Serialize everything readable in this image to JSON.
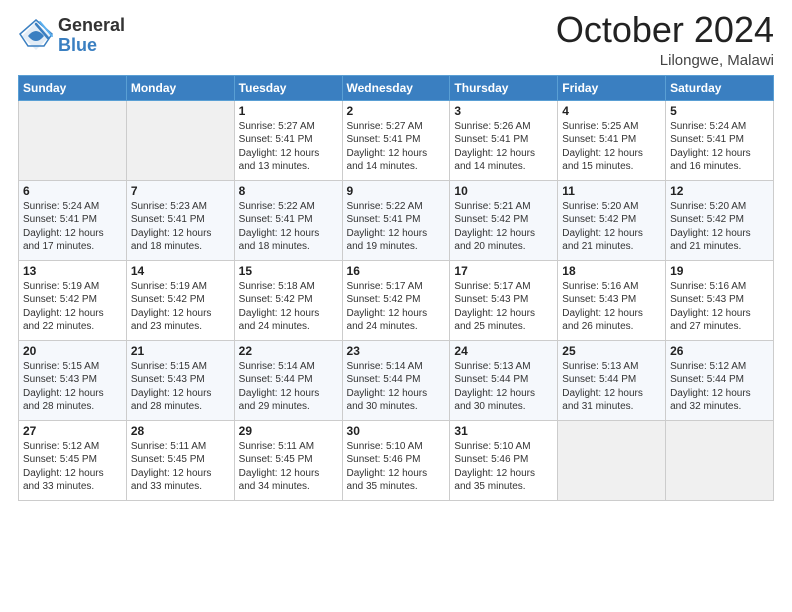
{
  "logo": {
    "general": "General",
    "blue": "Blue"
  },
  "header": {
    "month": "October 2024",
    "location": "Lilongwe, Malawi"
  },
  "weekdays": [
    "Sunday",
    "Monday",
    "Tuesday",
    "Wednesday",
    "Thursday",
    "Friday",
    "Saturday"
  ],
  "weeks": [
    [
      {
        "day": null
      },
      {
        "day": null
      },
      {
        "day": "1",
        "sunrise": "5:27 AM",
        "sunset": "5:41 PM",
        "daylight": "12 hours and 13 minutes."
      },
      {
        "day": "2",
        "sunrise": "5:27 AM",
        "sunset": "5:41 PM",
        "daylight": "12 hours and 14 minutes."
      },
      {
        "day": "3",
        "sunrise": "5:26 AM",
        "sunset": "5:41 PM",
        "daylight": "12 hours and 14 minutes."
      },
      {
        "day": "4",
        "sunrise": "5:25 AM",
        "sunset": "5:41 PM",
        "daylight": "12 hours and 15 minutes."
      },
      {
        "day": "5",
        "sunrise": "5:24 AM",
        "sunset": "5:41 PM",
        "daylight": "12 hours and 16 minutes."
      }
    ],
    [
      {
        "day": "6",
        "sunrise": "5:24 AM",
        "sunset": "5:41 PM",
        "daylight": "12 hours and 17 minutes."
      },
      {
        "day": "7",
        "sunrise": "5:23 AM",
        "sunset": "5:41 PM",
        "daylight": "12 hours and 18 minutes."
      },
      {
        "day": "8",
        "sunrise": "5:22 AM",
        "sunset": "5:41 PM",
        "daylight": "12 hours and 18 minutes."
      },
      {
        "day": "9",
        "sunrise": "5:22 AM",
        "sunset": "5:41 PM",
        "daylight": "12 hours and 19 minutes."
      },
      {
        "day": "10",
        "sunrise": "5:21 AM",
        "sunset": "5:42 PM",
        "daylight": "12 hours and 20 minutes."
      },
      {
        "day": "11",
        "sunrise": "5:20 AM",
        "sunset": "5:42 PM",
        "daylight": "12 hours and 21 minutes."
      },
      {
        "day": "12",
        "sunrise": "5:20 AM",
        "sunset": "5:42 PM",
        "daylight": "12 hours and 21 minutes."
      }
    ],
    [
      {
        "day": "13",
        "sunrise": "5:19 AM",
        "sunset": "5:42 PM",
        "daylight": "12 hours and 22 minutes."
      },
      {
        "day": "14",
        "sunrise": "5:19 AM",
        "sunset": "5:42 PM",
        "daylight": "12 hours and 23 minutes."
      },
      {
        "day": "15",
        "sunrise": "5:18 AM",
        "sunset": "5:42 PM",
        "daylight": "12 hours and 24 minutes."
      },
      {
        "day": "16",
        "sunrise": "5:17 AM",
        "sunset": "5:42 PM",
        "daylight": "12 hours and 24 minutes."
      },
      {
        "day": "17",
        "sunrise": "5:17 AM",
        "sunset": "5:43 PM",
        "daylight": "12 hours and 25 minutes."
      },
      {
        "day": "18",
        "sunrise": "5:16 AM",
        "sunset": "5:43 PM",
        "daylight": "12 hours and 26 minutes."
      },
      {
        "day": "19",
        "sunrise": "5:16 AM",
        "sunset": "5:43 PM",
        "daylight": "12 hours and 27 minutes."
      }
    ],
    [
      {
        "day": "20",
        "sunrise": "5:15 AM",
        "sunset": "5:43 PM",
        "daylight": "12 hours and 28 minutes."
      },
      {
        "day": "21",
        "sunrise": "5:15 AM",
        "sunset": "5:43 PM",
        "daylight": "12 hours and 28 minutes."
      },
      {
        "day": "22",
        "sunrise": "5:14 AM",
        "sunset": "5:44 PM",
        "daylight": "12 hours and 29 minutes."
      },
      {
        "day": "23",
        "sunrise": "5:14 AM",
        "sunset": "5:44 PM",
        "daylight": "12 hours and 30 minutes."
      },
      {
        "day": "24",
        "sunrise": "5:13 AM",
        "sunset": "5:44 PM",
        "daylight": "12 hours and 30 minutes."
      },
      {
        "day": "25",
        "sunrise": "5:13 AM",
        "sunset": "5:44 PM",
        "daylight": "12 hours and 31 minutes."
      },
      {
        "day": "26",
        "sunrise": "5:12 AM",
        "sunset": "5:44 PM",
        "daylight": "12 hours and 32 minutes."
      }
    ],
    [
      {
        "day": "27",
        "sunrise": "5:12 AM",
        "sunset": "5:45 PM",
        "daylight": "12 hours and 33 minutes."
      },
      {
        "day": "28",
        "sunrise": "5:11 AM",
        "sunset": "5:45 PM",
        "daylight": "12 hours and 33 minutes."
      },
      {
        "day": "29",
        "sunrise": "5:11 AM",
        "sunset": "5:45 PM",
        "daylight": "12 hours and 34 minutes."
      },
      {
        "day": "30",
        "sunrise": "5:10 AM",
        "sunset": "5:46 PM",
        "daylight": "12 hours and 35 minutes."
      },
      {
        "day": "31",
        "sunrise": "5:10 AM",
        "sunset": "5:46 PM",
        "daylight": "12 hours and 35 minutes."
      },
      {
        "day": null
      },
      {
        "day": null
      }
    ]
  ],
  "labels": {
    "sunrise": "Sunrise:",
    "sunset": "Sunset:",
    "daylight": "Daylight:"
  }
}
